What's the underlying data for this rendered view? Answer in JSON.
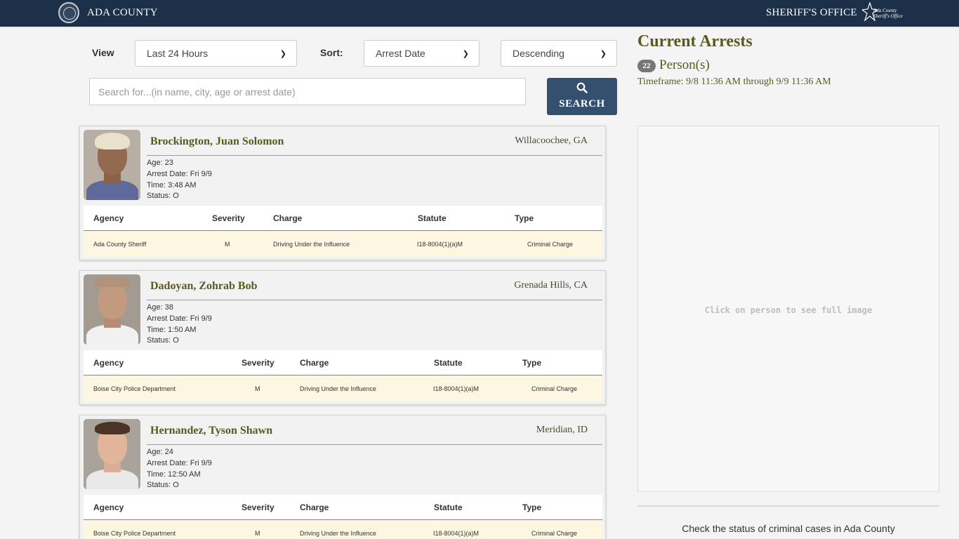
{
  "header": {
    "county": "ADA COUNTY",
    "office": "SHERIFF'S OFFICE",
    "logo_text": [
      "Ada County",
      "Sheriff's Office"
    ]
  },
  "filters": {
    "view_label": "View",
    "view_value": "Last 24 Hours",
    "sort_label": "Sort:",
    "sort_value": "Arrest Date",
    "order_value": "Descending",
    "search_placeholder": "Search for...(in name, city, age or arrest date)",
    "search_button": "SEARCH"
  },
  "charge_columns": [
    "Agency",
    "Severity",
    "Charge",
    "Statute",
    "Type"
  ],
  "arrests": [
    {
      "name": "Brockington, Juan Solomon",
      "city": "Willacoochee, GA",
      "age": "Age: 23",
      "arrest_date": "Arrest Date: Fri 9/9",
      "time": "Time: 3:48 AM",
      "status": "Status: O",
      "charge": {
        "agency": "Ada County Sheriff",
        "severity": "M",
        "charge": "Driving Under the Influence",
        "statute": "I18-8004(1)(a)M",
        "type": "Criminal Charge"
      }
    },
    {
      "name": "Dadoyan, Zohrab Bob",
      "city": "Grenada Hills, CA",
      "age": "Age: 38",
      "arrest_date": "Arrest Date: Fri 9/9",
      "time": "Time: 1:50 AM",
      "status": "Status: O",
      "charge": {
        "agency": "Boise City Police Department",
        "severity": "M",
        "charge": "Driving Under the Influence",
        "statute": "I18-8004(1)(a)M",
        "type": "Criminal Charge"
      }
    },
    {
      "name": "Hernandez, Tyson Shawn",
      "city": "Meridian, ID",
      "age": "Age: 24",
      "arrest_date": "Arrest Date: Fri 9/9",
      "time": "Time: 12:50 AM",
      "status": "Status: O",
      "charge": {
        "agency": "Boise City Police Department",
        "severity": "M",
        "charge": "Driving Under the Influence",
        "statute": "I18-8004(1)(a)M",
        "type": "Criminal Charge"
      }
    }
  ],
  "summary": {
    "title": "Current Arrests",
    "count": "22",
    "count_label": "Person(s)",
    "timeframe": "Timeframe: 9/8 11:36 AM through 9/9 11:36 AM",
    "image_hint": "Click on person to see full image",
    "cases_link": "Check the status of criminal cases in Ada County"
  },
  "icons": {
    "search_button": "magnifier-icon",
    "selects": "chevron-down-icon"
  },
  "colors": {
    "header_bg": "#1c3049",
    "button_bg": "#34506e",
    "name_olive": "#5a5a1e",
    "charge_row_bg": "#fdf6e1"
  }
}
